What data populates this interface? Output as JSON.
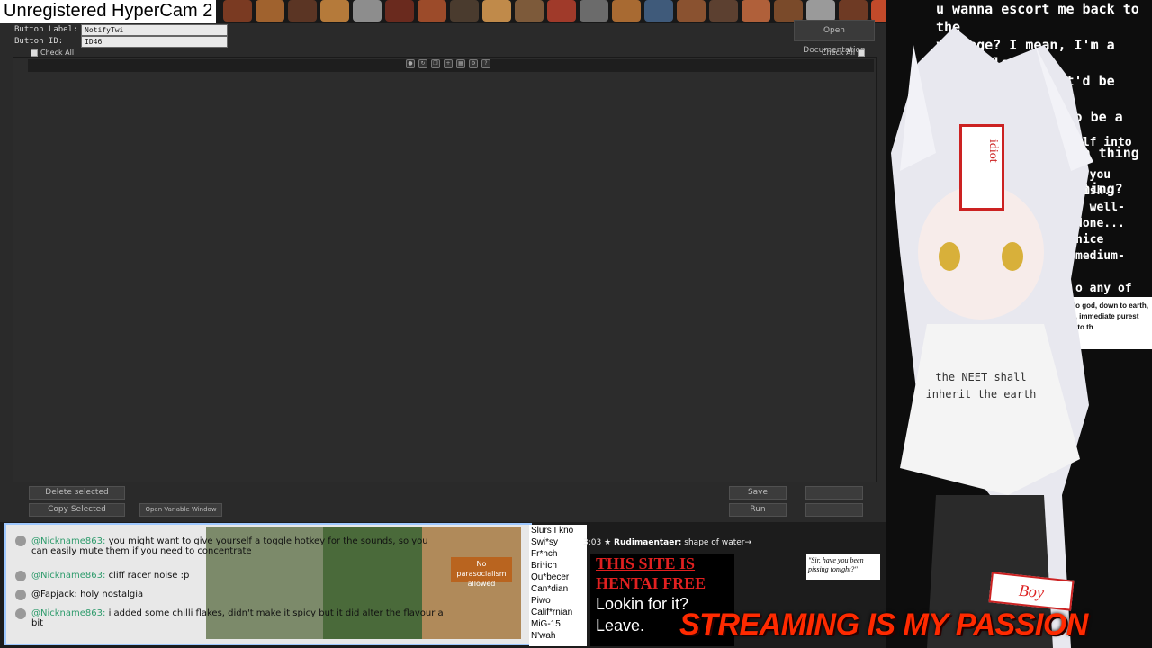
{
  "recorder": {
    "title": "Unregistered HyperCam 2"
  },
  "form": {
    "button_label_label": "Button Label:",
    "button_label_value": "NotifyTwi",
    "button_id_label": "Button ID:",
    "button_id_value": "ID46",
    "check_all_left": "Check All",
    "check_all_right": "Check All",
    "open_documentation": "Open Documentation"
  },
  "buttons": {
    "delete_selected": "Delete selected",
    "copy_selected": "Copy Selected",
    "open_variable_window": "Open Variable Window",
    "save": "Save",
    "run": "Run"
  },
  "chat": {
    "messages": [
      {
        "user": "@Nickname863:",
        "text": "you might want to give yourself a toggle hotkey for the sounds, so you can easily mute them if you need to concentrate"
      },
      {
        "user": "@Nickname863:",
        "text": "cliff racer noise :p"
      },
      {
        "user": "@Fapjack:",
        "text": "holy nostalgia"
      },
      {
        "user": "@Nickname863:",
        "text": "i added some chilli flakes, didn't make it spicy but it did alter the flavour a bit"
      }
    ],
    "no_parasocialism": "No parasocialism allowed"
  },
  "overlay": {
    "slurs_list": [
      "Slurs I kno",
      "Swi*sy",
      "Fr*nch",
      "Bri*ich",
      "Qu*becer",
      "Can*dian",
      "Piwo",
      "Calif*rnian",
      "MiG-15",
      "N'wah"
    ],
    "toast_time": "3:03",
    "toast_user": "Rudimaentaer:",
    "toast_text": "shape of water→",
    "hentai_line1": "THIS SITE IS",
    "hentai_line2": "HENTAI FREE",
    "hentai_line3": "Lookin for it?",
    "hentai_line4": "Leave.",
    "sir_text": "\"Sir, have you been pissing tonight?\"",
    "passion": "STREAMING IS MY PASSION",
    "meme_top": "u wanna escort me back to the\nvillage? I mean, I'm a defenseless\nlittle kid, so it'd be mean to say no!\nThis is getting to be a bit of a\nabit. Do you have a thing for\nder women or something?",
    "meme_mid": "elf into my\nr you wish.\nr well-done...\nnice medium-\n\no any of\nto just...",
    "meme_box": "honest to god, down to earth, genuine, immediate purest reaction to th",
    "shirt": "the NEET shall inherit the earth",
    "boy_tag": "Boy",
    "idiot_tag": "idiot"
  },
  "colors": {
    "accent_chat_border": "#9ec8ff",
    "nick": "#2e9b6c",
    "passion_red": "#ff2a00"
  }
}
